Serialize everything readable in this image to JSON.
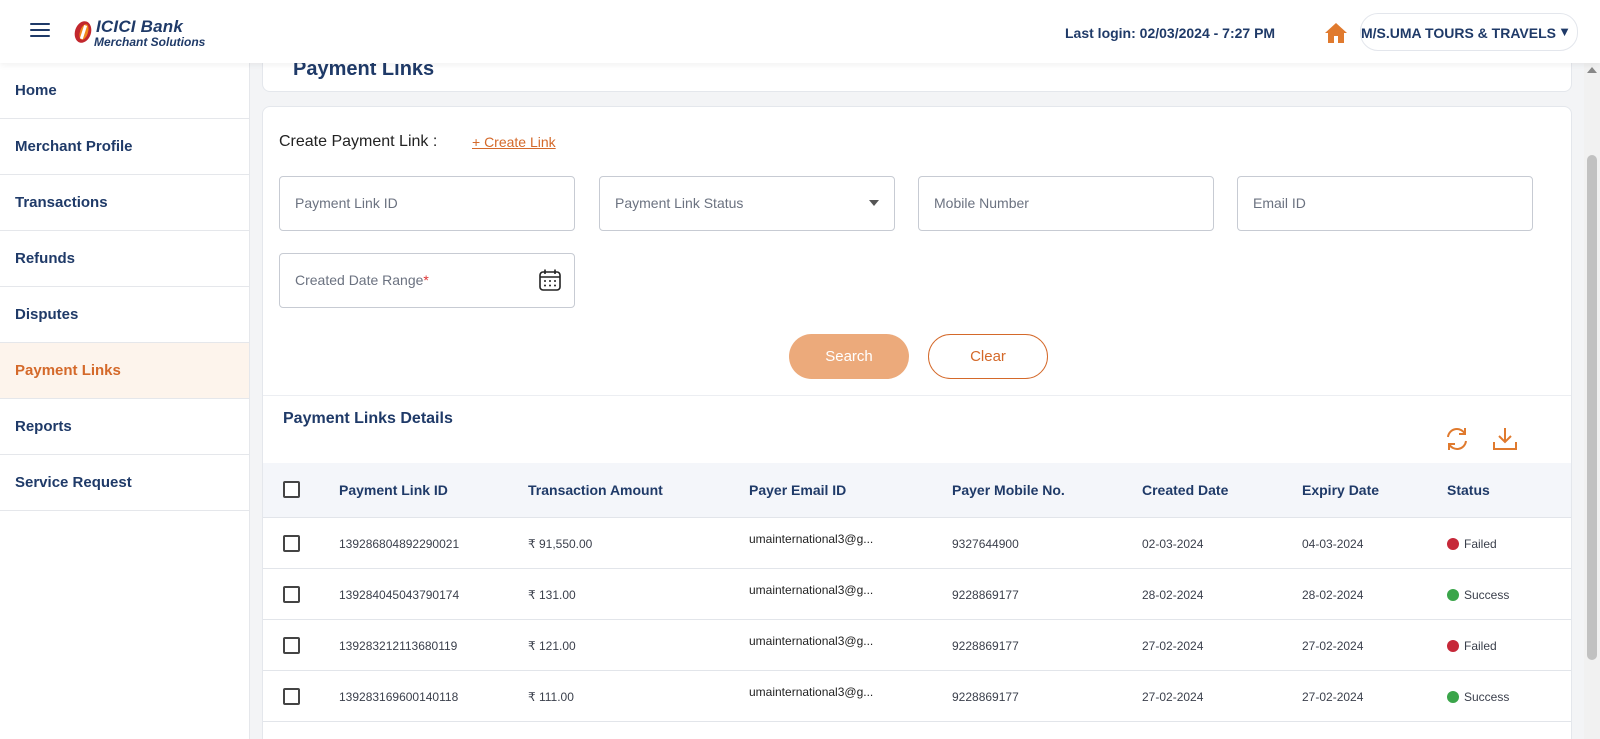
{
  "header": {
    "logo_bank": "ICICI Bank",
    "logo_sub": "Merchant Solutions",
    "last_login": "Last login: 02/03/2024 - 7:27 PM",
    "merchant_name": "M/S.UMA TOURS & TRAVELS",
    "merchant_caret": "▼"
  },
  "sidebar": {
    "items": [
      {
        "label": "Home"
      },
      {
        "label": "Merchant Profile"
      },
      {
        "label": "Transactions"
      },
      {
        "label": "Refunds"
      },
      {
        "label": "Disputes"
      },
      {
        "label": "Payment Links",
        "active": true
      },
      {
        "label": "Reports"
      },
      {
        "label": "Service Request"
      }
    ]
  },
  "page": {
    "title": "Payment Links",
    "create_label": "Create Payment Link :",
    "create_link": "+ Create Link"
  },
  "filters": {
    "payment_link_id": "Payment Link ID",
    "payment_link_status": "Payment Link Status",
    "mobile_number": "Mobile Number",
    "email_id": "Email ID",
    "created_date_range": "Created Date Range",
    "required_mark": "*",
    "search_label": "Search",
    "clear_label": "Clear"
  },
  "details": {
    "title": "Payment Links Details",
    "columns": [
      "Payment Link ID",
      "Transaction Amount",
      "Payer Email ID",
      "Payer Mobile No.",
      "Created Date",
      "Expiry Date",
      "Status"
    ],
    "rows": [
      {
        "id": "139286804892290021",
        "amount": "₹ 91,550.00",
        "email": "umainternational3@g...",
        "mobile": "9327644900",
        "created": "02-03-2024",
        "expiry": "04-03-2024",
        "status": "Failed"
      },
      {
        "id": "139284045043790174",
        "amount": "₹ 131.00",
        "email": "umainternational3@g...",
        "mobile": "9228869177",
        "created": "28-02-2024",
        "expiry": "28-02-2024",
        "status": "Success"
      },
      {
        "id": "139283212113680119",
        "amount": "₹ 121.00",
        "email": "umainternational3@g...",
        "mobile": "9228869177",
        "created": "27-02-2024",
        "expiry": "27-02-2024",
        "status": "Failed"
      },
      {
        "id": "139283169600140118",
        "amount": "₹ 111.00",
        "email": "umainternational3@g...",
        "mobile": "9228869177",
        "created": "27-02-2024",
        "expiry": "27-02-2024",
        "status": "Success"
      }
    ]
  },
  "colors": {
    "brand_navy": "#1f3a68",
    "accent_orange": "#d4692a",
    "failed": "#c62839",
    "success": "#3aa54a"
  },
  "icons": {
    "menu": "hamburger-menu-icon",
    "home": "home-icon",
    "calendar": "calendar-icon",
    "refresh": "refresh-icon",
    "download": "download-icon"
  }
}
